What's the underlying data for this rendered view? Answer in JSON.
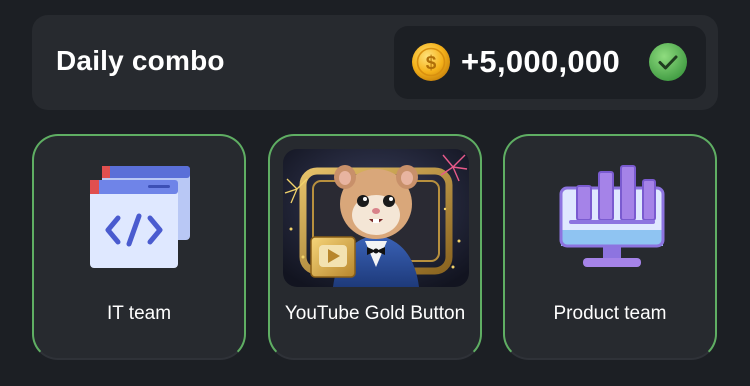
{
  "header": {
    "title": "Daily combo",
    "reward": {
      "coin_icon": "coin-icon",
      "amount": "+5,000,000",
      "status_icon": "check-circle-icon",
      "coin_symbol": "$"
    }
  },
  "cards": [
    {
      "label": "IT team",
      "icon": "code-window-icon"
    },
    {
      "label": "YouTube Gold Button",
      "icon": "hamster-youtube-image"
    },
    {
      "label": "Product team",
      "icon": "monitor-chart-icon"
    }
  ],
  "colors": {
    "background": "#1c1f24",
    "panel": "#272a2f",
    "card_border": "#5fae63",
    "coin": "#f5b21a",
    "check": "#5fb85c"
  }
}
